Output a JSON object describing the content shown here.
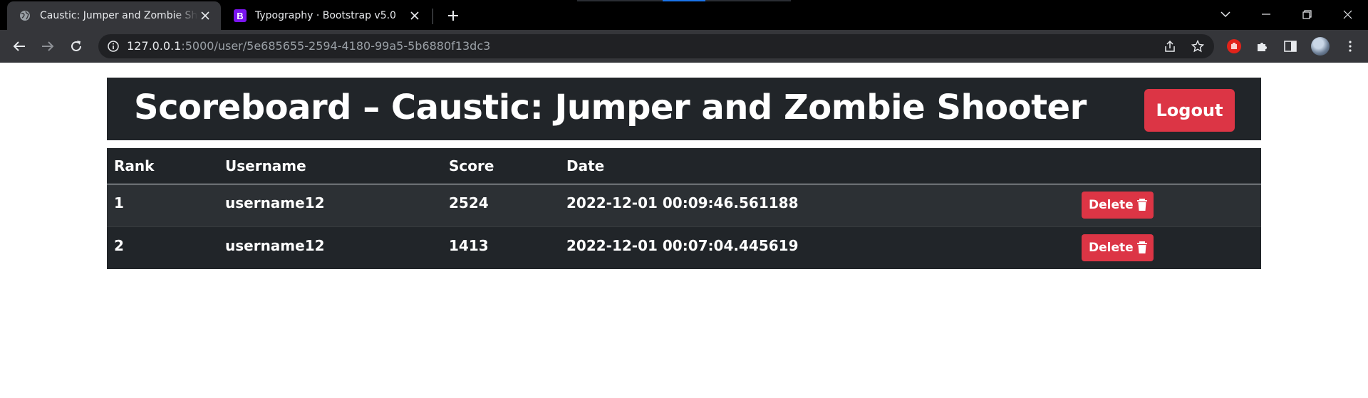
{
  "browser": {
    "tabs": [
      {
        "title": "Caustic: Jumper and Zombie Shooter",
        "active": true,
        "favicon": "globe-icon"
      },
      {
        "title": "Typography · Bootstrap v5.0",
        "active": false,
        "favicon": "bootstrap-icon",
        "favicon_letter": "B"
      }
    ],
    "address": {
      "host": "127.0.0.1",
      "path": ":5000/user/5e685655-2594-4180-99a5-5b6880f13dc3"
    }
  },
  "page": {
    "title": "Scoreboard – Caustic: Jumper and Zombie Shooter",
    "logout_label": "Logout",
    "table": {
      "headers": {
        "rank": "Rank",
        "username": "Username",
        "score": "Score",
        "date": "Date"
      },
      "rows": [
        {
          "rank": "1",
          "username": "username12",
          "score": "2524",
          "date": "2022-12-01 00:09:46.561188",
          "action": "Delete"
        },
        {
          "rank": "2",
          "username": "username12",
          "score": "1413",
          "date": "2022-12-01 00:07:04.445619",
          "action": "Delete"
        }
      ]
    }
  },
  "colors": {
    "dark": "#212529",
    "danger": "#dc3545",
    "chrome_tab": "#35363a",
    "bootstrap_purple": "#7b14f0"
  }
}
